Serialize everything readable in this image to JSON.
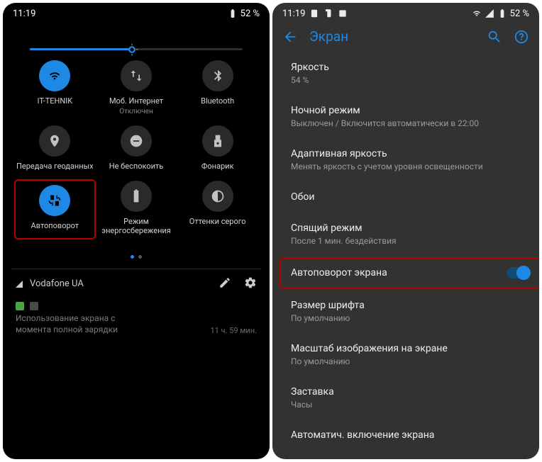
{
  "left": {
    "status": {
      "time": "11:19",
      "battery": "52 %"
    },
    "brightness_percent": 48,
    "tiles": [
      {
        "id": "wifi",
        "label": "IT-TEHNIK",
        "sub": "",
        "on": true,
        "icon": "wifi"
      },
      {
        "id": "mobile",
        "label": "Моб. Интернет",
        "sub": "Отключен",
        "on": false,
        "icon": "swap"
      },
      {
        "id": "bt",
        "label": "Bluetooth",
        "sub": "",
        "on": false,
        "icon": "bluetooth"
      },
      {
        "id": "location",
        "label": "Передача геоданных",
        "sub": "",
        "on": false,
        "icon": "location"
      },
      {
        "id": "dnd",
        "label": "Не беспокоить",
        "sub": "",
        "on": false,
        "icon": "dnd"
      },
      {
        "id": "flash",
        "label": "Фонарик",
        "sub": "",
        "on": false,
        "icon": "flash"
      },
      {
        "id": "rotate",
        "label": "Автоповорот",
        "sub": "",
        "on": true,
        "icon": "rotate",
        "highlight": true
      },
      {
        "id": "battery",
        "label": "Режим энергосбережения",
        "sub": "",
        "on": false,
        "icon": "battery"
      },
      {
        "id": "gray",
        "label": "Оттенки серого",
        "sub": "",
        "on": false,
        "icon": "contrast"
      }
    ],
    "carrier": "Vodafone UA",
    "notification": {
      "line1": "Использование экрана с",
      "line2": "момента полной зарядки",
      "time": "11 ч. 59 мин."
    }
  },
  "right": {
    "status": {
      "time": "11:19",
      "battery": "52 %"
    },
    "title": "Экран",
    "items": [
      {
        "title": "Яркость",
        "sub": "54 %"
      },
      {
        "title": "Ночной режим",
        "sub": "Выключен / Включится автоматически в 22:00"
      },
      {
        "title": "Адаптивная яркость",
        "sub": "Менять яркость с учетом уровня освещенности"
      },
      {
        "title": "Обои",
        "sub": ""
      },
      {
        "title": "Спящий режим",
        "sub": "После 1 мин. бездействия"
      },
      {
        "title": "Автоповорот экрана",
        "sub": "",
        "switch": true,
        "on": true,
        "highlight": true
      },
      {
        "title": "Размер шрифта",
        "sub": "По умолчанию"
      },
      {
        "title": "Масштаб изображения на экране",
        "sub": "По умолчанию"
      },
      {
        "title": "Заставка",
        "sub": "Часы"
      },
      {
        "title": "Автоматич. включение экрана",
        "sub": ""
      }
    ]
  }
}
